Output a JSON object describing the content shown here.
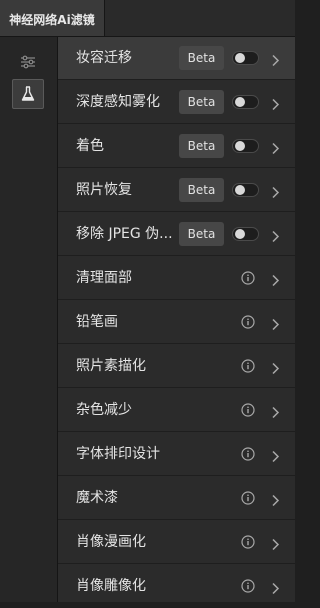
{
  "tab": {
    "title": "神经网络Ai滤镜"
  },
  "rail": {
    "icons": [
      "sliders-icon",
      "flask-icon"
    ]
  },
  "colors": {
    "background": "#2b2b2b",
    "selected_row": "#3b3b3b",
    "beta_badge": "#474747"
  },
  "filters": [
    {
      "label": "妆容迁移",
      "badge": "Beta",
      "has_toggle": true,
      "toggle_on": false,
      "selected": true
    },
    {
      "label": "深度感知雾化",
      "badge": "Beta",
      "has_toggle": true,
      "toggle_on": false
    },
    {
      "label": "着色",
      "badge": "Beta",
      "has_toggle": true,
      "toggle_on": false
    },
    {
      "label": "照片恢复",
      "badge": "Beta",
      "has_toggle": true,
      "toggle_on": false
    },
    {
      "label": "移除 JPEG 伪...",
      "badge": "Beta",
      "has_toggle": true,
      "toggle_on": false
    },
    {
      "label": "清理面部",
      "info_icon": "info-icon"
    },
    {
      "label": "铅笔画",
      "info_icon": "info-icon"
    },
    {
      "label": "照片素描化",
      "info_icon": "info-icon"
    },
    {
      "label": "杂色减少",
      "info_icon": "info-icon"
    },
    {
      "label": "字体排印设计",
      "info_icon": "info-icon"
    },
    {
      "label": "魔术漆",
      "info_icon": "info-icon"
    },
    {
      "label": "肖像漫画化",
      "info_icon": "info-icon"
    },
    {
      "label": "肖像雕像化",
      "info_icon": "info-icon"
    }
  ]
}
